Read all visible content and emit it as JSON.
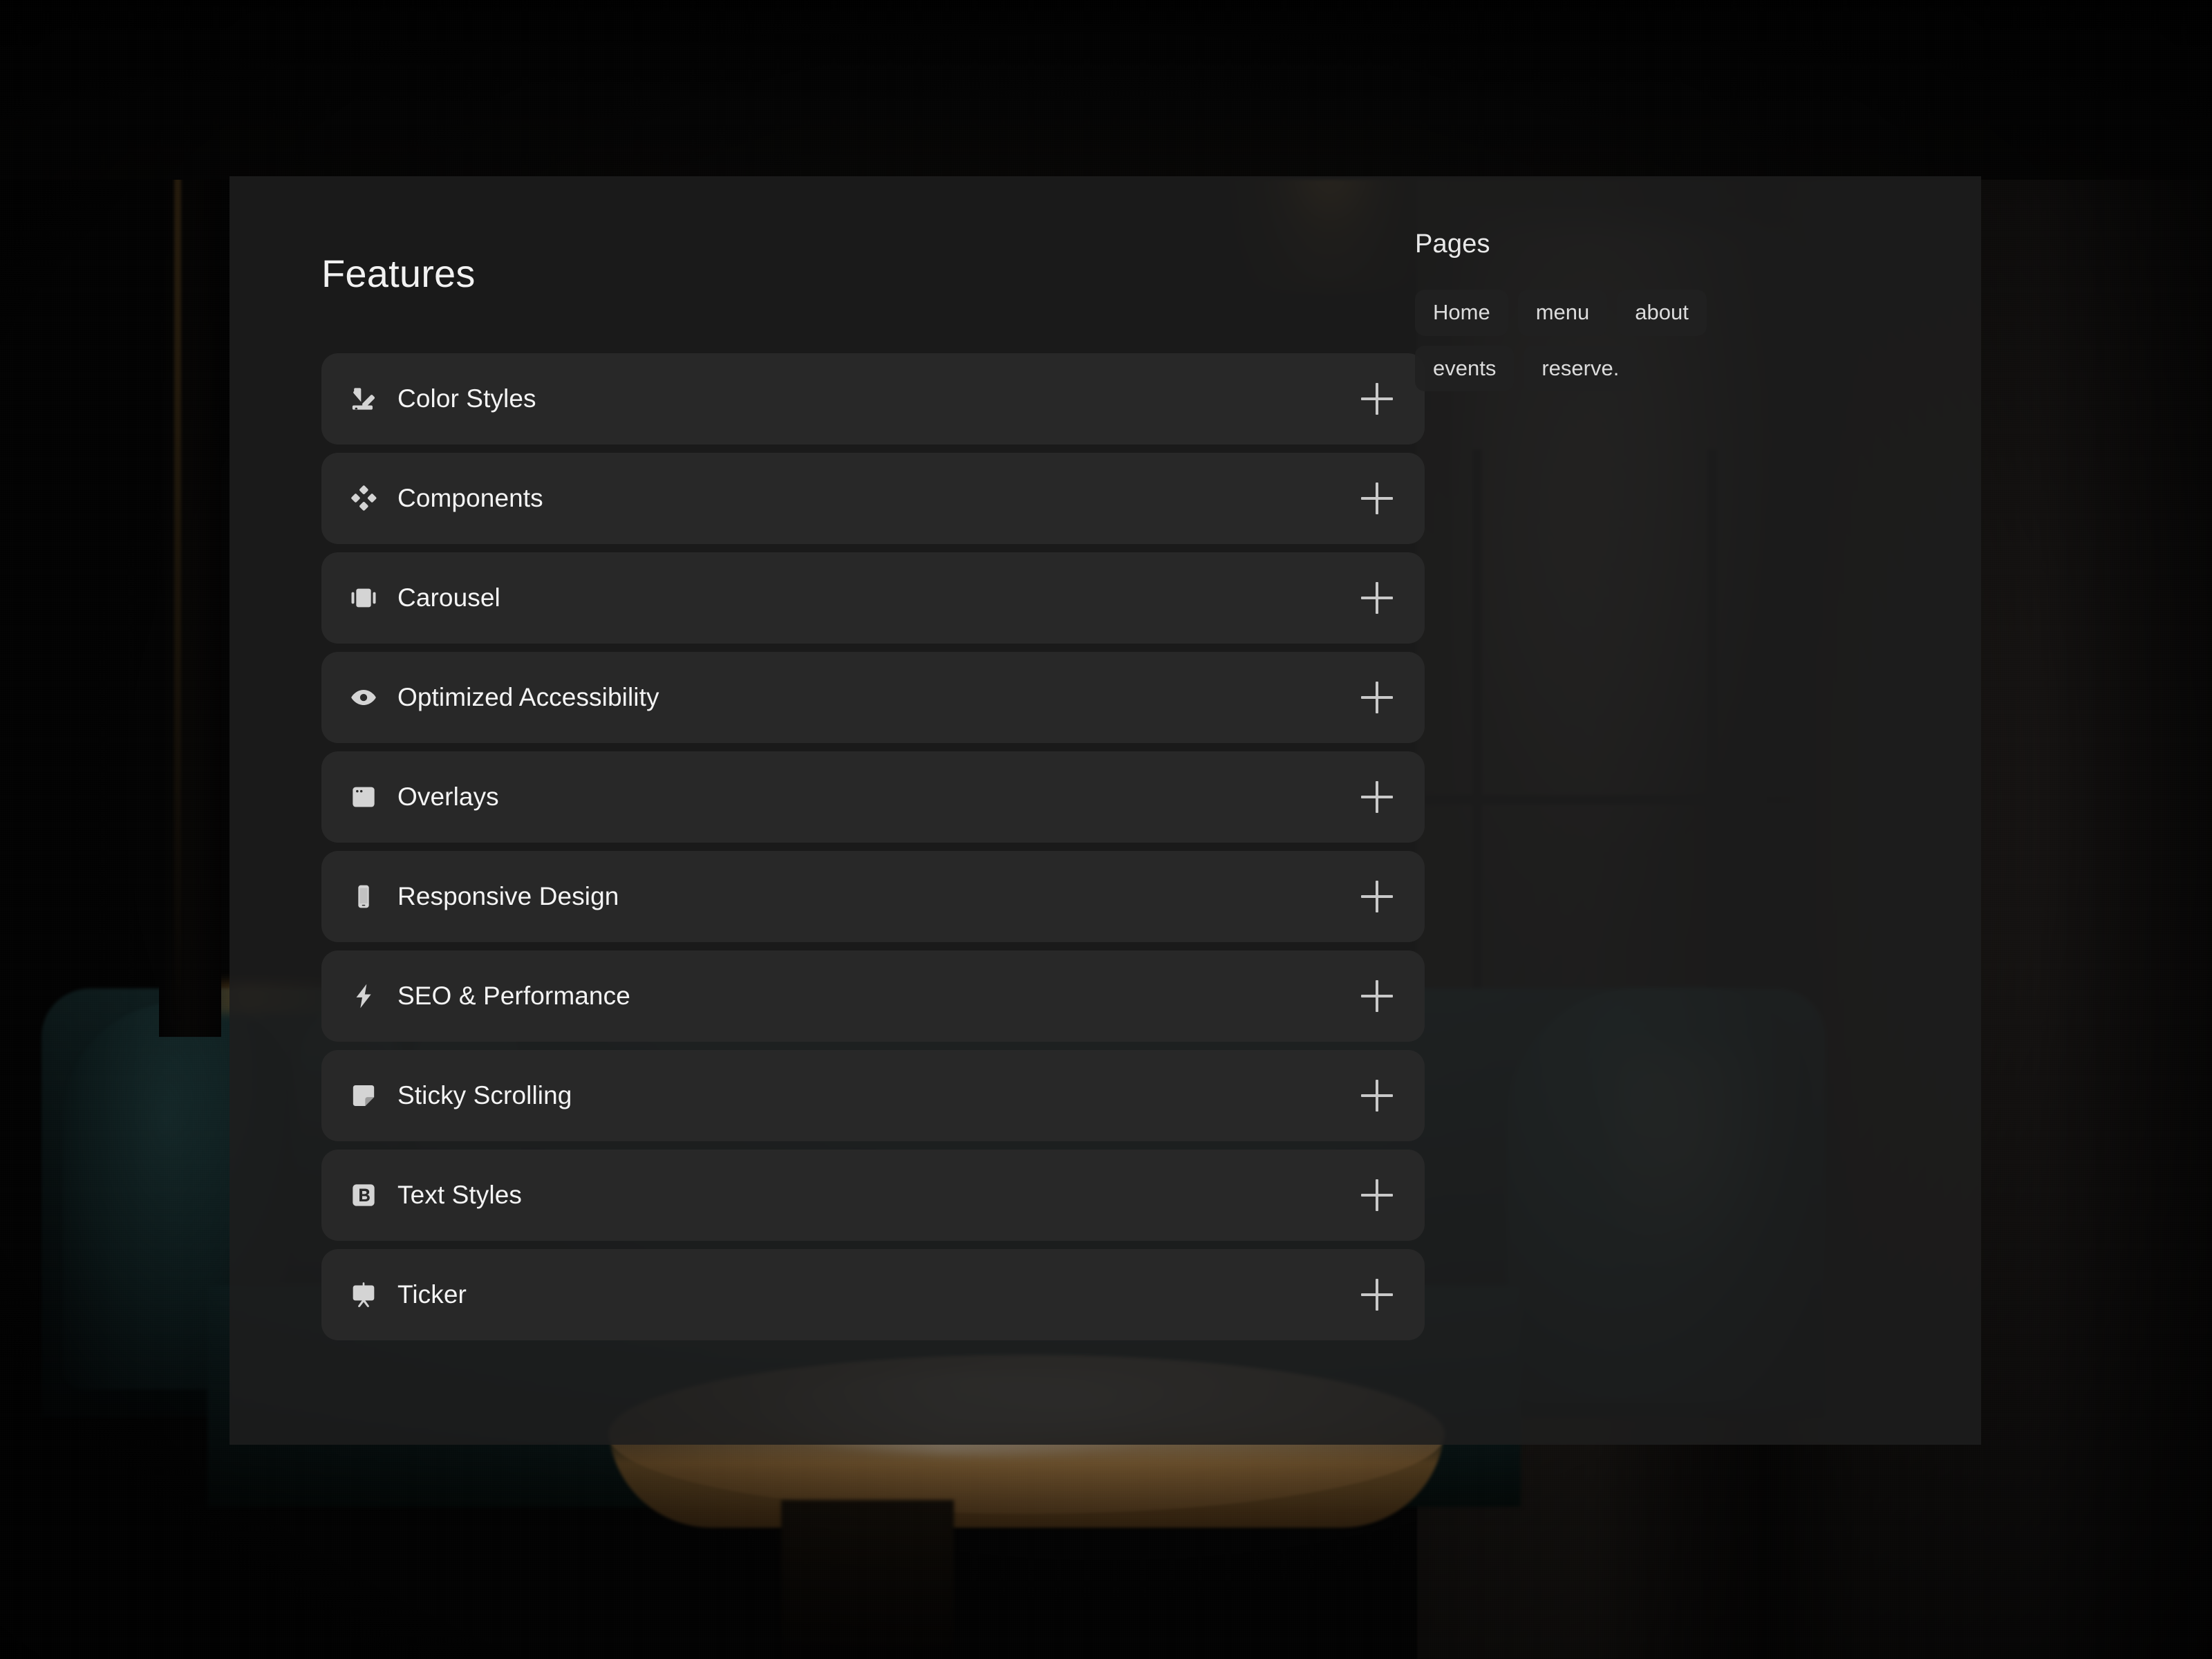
{
  "panel": {
    "features": {
      "title": "Features",
      "items": [
        {
          "label": "Color Styles",
          "icon": "color-swatch-icon",
          "action": "plus-icon"
        },
        {
          "label": "Components",
          "icon": "diamond-grid-icon",
          "action": "plus-icon"
        },
        {
          "label": "Carousel",
          "icon": "carousel-icon",
          "action": "plus-icon"
        },
        {
          "label": "Optimized Accessibility",
          "icon": "eye-icon",
          "action": "plus-icon"
        },
        {
          "label": "Overlays",
          "icon": "window-overlay-icon",
          "action": "plus-icon"
        },
        {
          "label": "Responsive Design",
          "icon": "mobile-phone-icon",
          "action": "plus-icon"
        },
        {
          "label": "SEO & Performance",
          "icon": "lightning-bolt-icon",
          "action": "plus-icon"
        },
        {
          "label": "Sticky Scrolling",
          "icon": "sticky-note-icon",
          "action": "plus-icon"
        },
        {
          "label": "Text Styles",
          "icon": "bold-b-icon",
          "action": "plus-icon"
        },
        {
          "label": "Ticker",
          "icon": "presentation-icon",
          "action": "plus-icon"
        }
      ]
    },
    "pages": {
      "title": "Pages",
      "items": [
        {
          "label": "Home"
        },
        {
          "label": "menu"
        },
        {
          "label": "about"
        },
        {
          "label": "events"
        },
        {
          "label": "reserve."
        }
      ]
    }
  },
  "colors": {
    "panel_background": "#1e1e1e",
    "row_background": "#2a2a2a",
    "pill_background": "#212121",
    "text_primary": "#f4f4f4",
    "text_secondary": "#dcdcdc",
    "icon_fill": "#d4d4d4",
    "plus_stroke": "#c9c9c9"
  }
}
